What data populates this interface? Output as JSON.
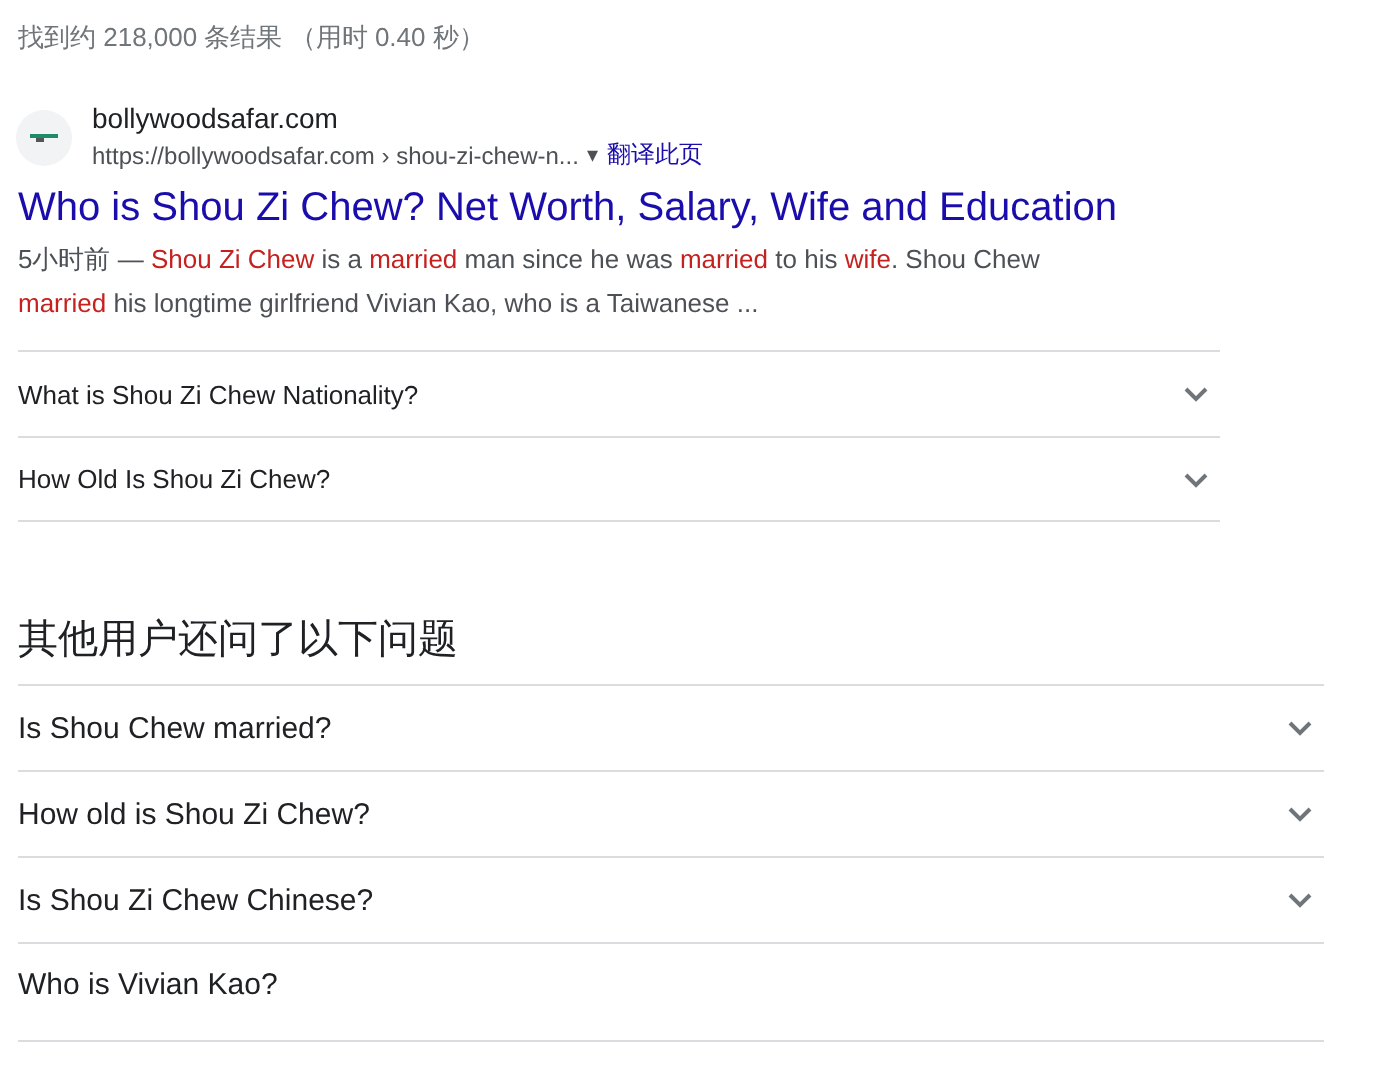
{
  "result_stats": "找到约 218,000 条结果 （用时 0.40 秒）",
  "result": {
    "site_name": "bollywoodsafar.com",
    "url": "https://bollywoodsafar.com › shou-zi-chew-n...",
    "menu_caret": "▾",
    "translate_link": "翻译此页",
    "title": "Who is Shou Zi Chew? Net Worth, Salary, Wife and Education",
    "snippet": [
      {
        "text": "5小时前 — ",
        "highlight": false
      },
      {
        "text": "Shou Zi Chew",
        "highlight": true
      },
      {
        "text": " is a ",
        "highlight": false
      },
      {
        "text": "married",
        "highlight": true
      },
      {
        "text": " man since he was ",
        "highlight": false
      },
      {
        "text": "married",
        "highlight": true
      },
      {
        "text": " to his ",
        "highlight": false
      },
      {
        "text": "wife",
        "highlight": true
      },
      {
        "text": ". Shou Chew ",
        "highlight": false
      },
      {
        "text": "married",
        "highlight": true
      },
      {
        "text": " his longtime girlfriend Vivian Kao, who is a Taiwanese ...",
        "highlight": false
      }
    ],
    "sub_questions": [
      {
        "text": "What is Shou Zi Chew Nationality?",
        "expanded": false
      },
      {
        "text": "How Old Is Shou Zi Chew?",
        "expanded": false
      }
    ]
  },
  "people_also_ask": {
    "heading": "其他用户还问了以下问题",
    "questions": [
      {
        "text": "Is Shou Chew married?",
        "expanded": false,
        "chevron": true
      },
      {
        "text": "How old is Shou Zi Chew?",
        "expanded": false,
        "chevron": true
      },
      {
        "text": "Is Shou Zi Chew Chinese?",
        "expanded": false,
        "chevron": true
      },
      {
        "text": "Who is Vivian Kao?",
        "chevron": false
      }
    ]
  }
}
